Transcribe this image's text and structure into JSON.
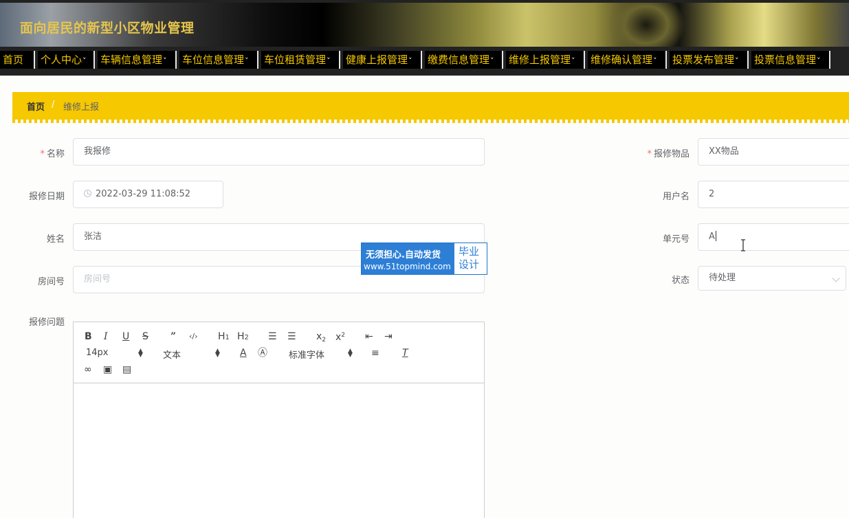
{
  "site": {
    "title": "面向居民的新型小区物业管理"
  },
  "nav": {
    "items": [
      {
        "label": "首页",
        "dropdown": false
      },
      {
        "label": "个人中心",
        "dropdown": true
      },
      {
        "label": "车辆信息管理",
        "dropdown": true
      },
      {
        "label": "车位信息管理",
        "dropdown": true
      },
      {
        "label": "车位租赁管理",
        "dropdown": true
      },
      {
        "label": "健康上报管理",
        "dropdown": true
      },
      {
        "label": "缴费信息管理",
        "dropdown": true
      },
      {
        "label": "维修上报管理",
        "dropdown": true
      },
      {
        "label": "维修确认管理",
        "dropdown": true
      },
      {
        "label": "投票发布管理",
        "dropdown": true
      },
      {
        "label": "投票信息管理",
        "dropdown": true
      }
    ]
  },
  "breadcrumb": {
    "home": "首页",
    "separator": "/",
    "current": "维修上报"
  },
  "form": {
    "name": {
      "label": "名称",
      "required": true,
      "value": "我报修"
    },
    "item": {
      "label": "报修物品",
      "required": true,
      "value": "XX物品"
    },
    "date": {
      "label": "报修日期",
      "value": "2022-03-29 11:08:52"
    },
    "username": {
      "label": "用户名",
      "value": "2"
    },
    "realname": {
      "label": "姓名",
      "value": "张洁"
    },
    "unit": {
      "label": "单元号",
      "value": "A"
    },
    "room": {
      "label": "房间号",
      "placeholder": "房间号",
      "value": ""
    },
    "status": {
      "label": "状态",
      "value": "待处理"
    },
    "problem": {
      "label": "报修问题"
    }
  },
  "editor": {
    "toolbar": {
      "row1": [
        "B",
        "I",
        "U",
        "S",
        "99",
        "</>",
        "H1",
        "H2",
        "ordered-list",
        "bullet-list",
        "x2",
        "x2",
        "outdent",
        "indent"
      ],
      "font_size": "14px",
      "header_select": "文本",
      "font_family": "标准字体",
      "icons": [
        "bold-icon",
        "italic-icon",
        "underline-icon",
        "strike-icon",
        "blockquote-icon",
        "code-block-icon",
        "h1-icon",
        "h2-icon",
        "ordered-list-icon",
        "bullet-list-icon",
        "subscript-icon",
        "superscript-icon",
        "outdent-icon",
        "indent-icon",
        "font-color-icon",
        "background-color-icon",
        "align-icon",
        "clean-format-icon",
        "link-icon",
        "image-icon",
        "video-icon"
      ]
    }
  },
  "watermark": {
    "line1": "无须担心.自动发货",
    "line2": "www.51topmind.com",
    "right_top": "毕业",
    "right_bottom": "设计"
  },
  "colors": {
    "accent": "#f5c800",
    "nav_text": "#f4c800",
    "required": "#f56c6c"
  }
}
